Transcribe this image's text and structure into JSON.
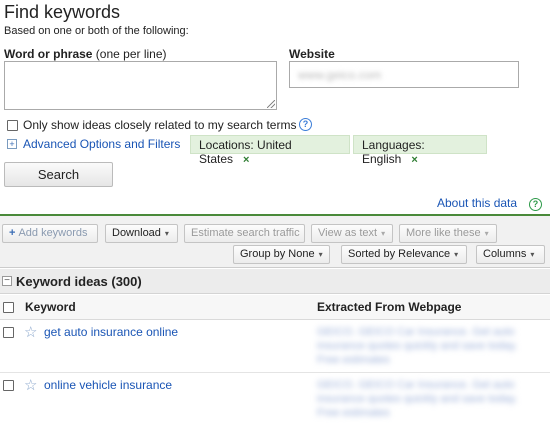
{
  "page": {
    "title": "Find keywords",
    "subtitle": "Based on one or both of the following:"
  },
  "form": {
    "word_label_bold": "Word or phrase",
    "word_label_hint": " (one per line)",
    "website_label": "Website",
    "website_value": "www.geico.com",
    "only_show_label": "Only show ideas closely related to my search terms",
    "advanced_link": "Advanced Options and Filters",
    "location_chip": "Locations: United States",
    "language_chip": "Languages: English",
    "chip_close": "×",
    "search_button": "Search",
    "help_glyph": "?"
  },
  "about_link": "About this data",
  "toolbar": {
    "add_keywords": "Add keywords",
    "download": "Download",
    "estimate": "Estimate search traffic",
    "view_as_text": "View as text",
    "more_like": "More like these",
    "group_by": "Group by None",
    "sorted_by": "Sorted by Relevance",
    "columns": "Columns",
    "caret": "▾"
  },
  "section": {
    "title": "Keyword ideas (300)"
  },
  "table": {
    "columns": [
      "Keyword",
      "Extracted From Webpage"
    ],
    "rows": [
      {
        "keyword": "get auto insurance online",
        "extracted": "GEICO. GEICO Car Insurance. Get auto insurance quotes quickly and save today. Free estimates"
      },
      {
        "keyword": "online vehicle insurance",
        "extracted": "GEICO. GEICO Car Insurance. Get auto insurance quotes quickly and save today. Free estimates"
      }
    ]
  },
  "icons": {
    "star": "☆",
    "plus": "+",
    "minus": "−"
  },
  "colors": {
    "link": "#1a55b5",
    "chip_bg": "#e3f1de",
    "chip_x": "#2e7d32",
    "toolbar_border": "#4a8a3a"
  }
}
